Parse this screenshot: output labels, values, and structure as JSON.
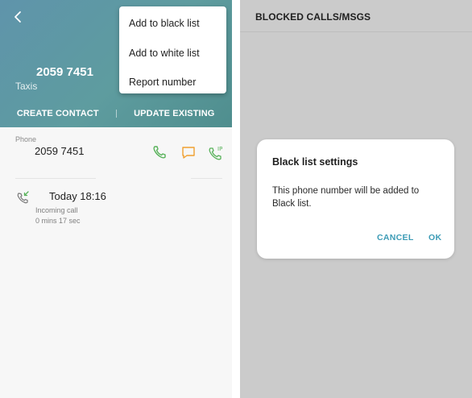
{
  "contact": {
    "number": "2059 7451",
    "label": "Taxis",
    "create_contact": "CREATE CONTACT",
    "update_existing": "UPDATE EXISTING"
  },
  "menu": {
    "items": [
      "Add to black list",
      "Add to white list",
      "Report number"
    ]
  },
  "phone_section": {
    "label": "Phone",
    "number": "2059 7451",
    "icons": [
      "phone-call-icon",
      "message-icon",
      "ip-call-icon"
    ]
  },
  "call_log": {
    "date": "Today 18:16",
    "type": "Incoming call",
    "duration": "0 mins 17 sec"
  },
  "blocked": {
    "title": "BLOCKED CALLS/MSGS"
  },
  "dialog": {
    "title": "Black list settings",
    "message": "This phone number will be added to Black list.",
    "cancel": "CANCEL",
    "ok": "OK"
  },
  "colors": {
    "header": "#5e9c9f",
    "call_green": "#58b25a",
    "message_orange": "#f0a030",
    "accent_teal": "#3d9cb6"
  }
}
